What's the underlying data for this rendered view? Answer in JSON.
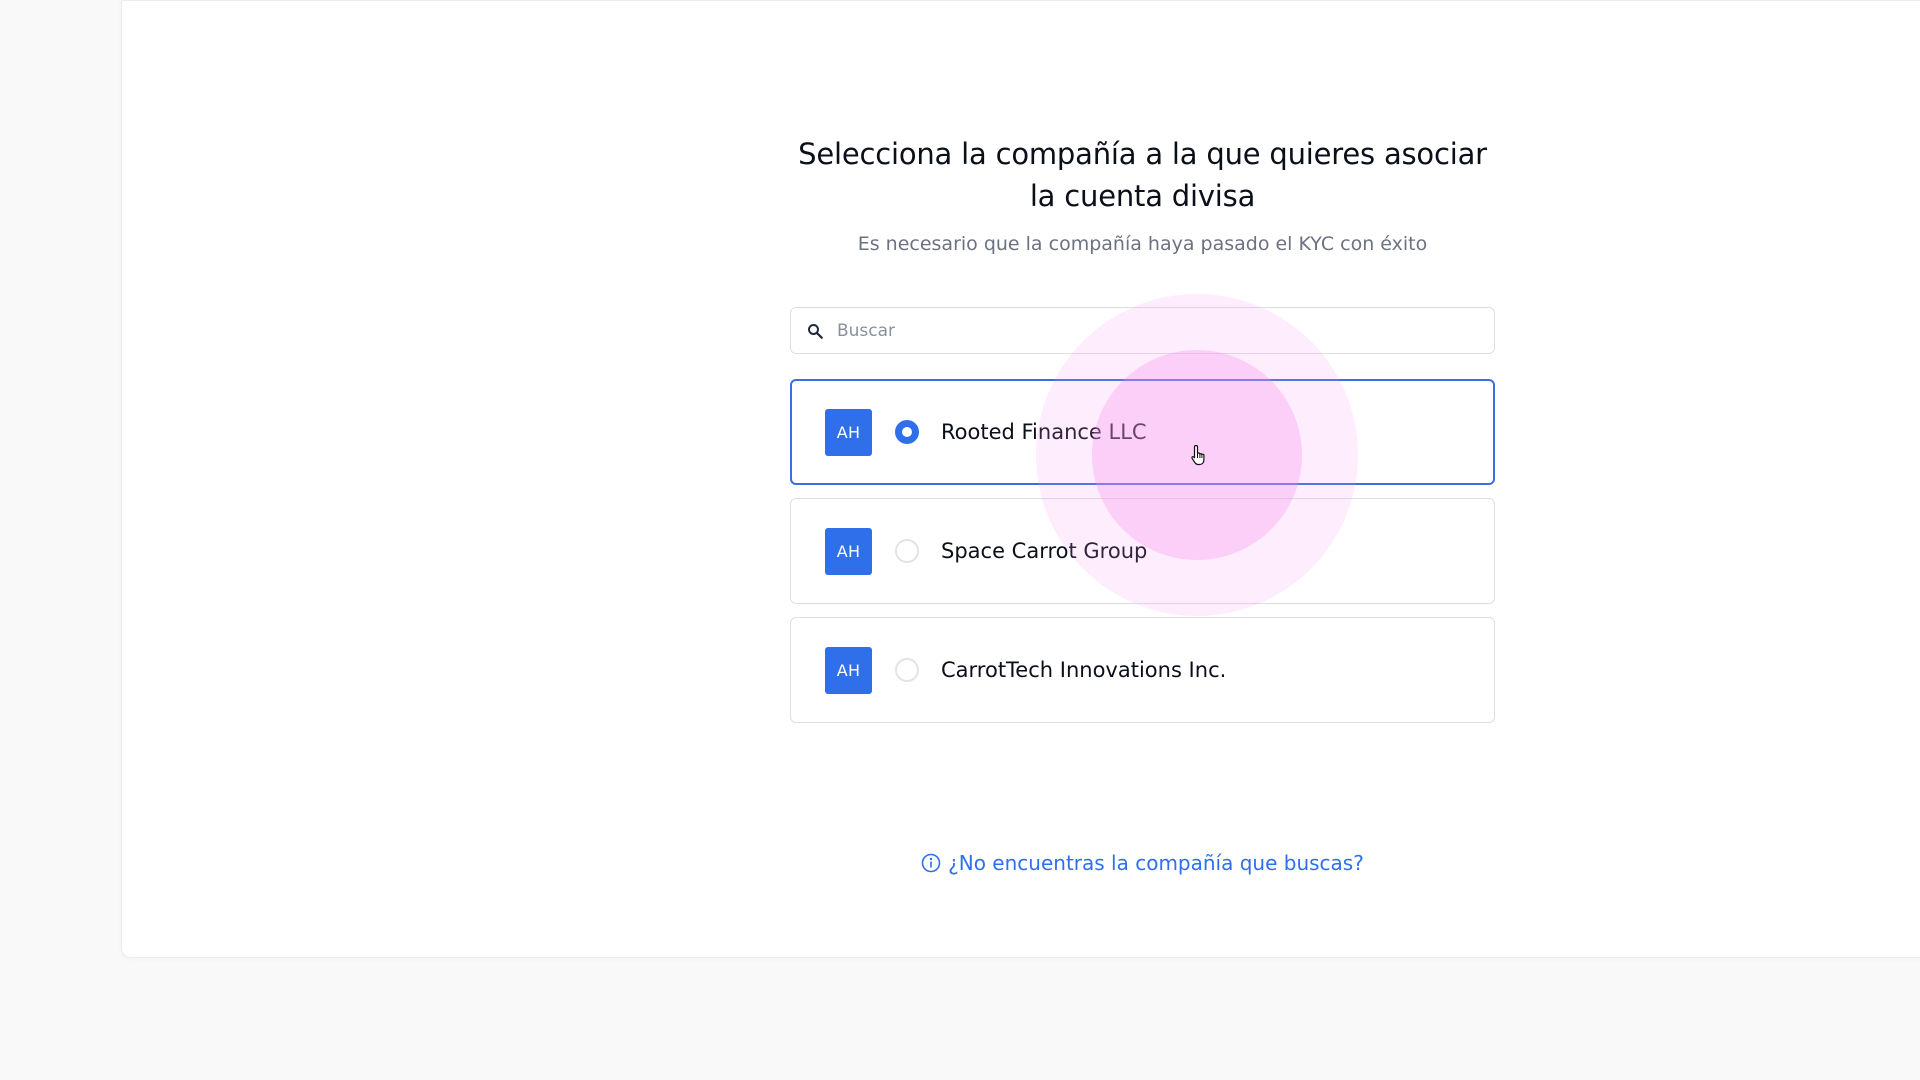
{
  "header": {
    "title": "Selecciona la compañía a la que quieres asociar la cuenta divisa",
    "subtitle": "Es necesario que la compañía haya pasado el KYC con éxito"
  },
  "search": {
    "placeholder": "Buscar",
    "value": "",
    "icon": "search-icon"
  },
  "companies": [
    {
      "initials": "AH",
      "name": "Rooted Finance LLC",
      "selected": true
    },
    {
      "initials": "AH",
      "name": "Space Carrot Group",
      "selected": false
    },
    {
      "initials": "AH",
      "name": "CarrotTech Innovations Inc.",
      "selected": false
    }
  ],
  "help": {
    "label": "¿No encuentras la compañía que buscas?",
    "icon": "info-icon"
  },
  "colors": {
    "accent": "#2f6fea",
    "selected_border": "#3b6fe0",
    "ripple": "#f68cf0",
    "background": "#f9f9fa"
  }
}
